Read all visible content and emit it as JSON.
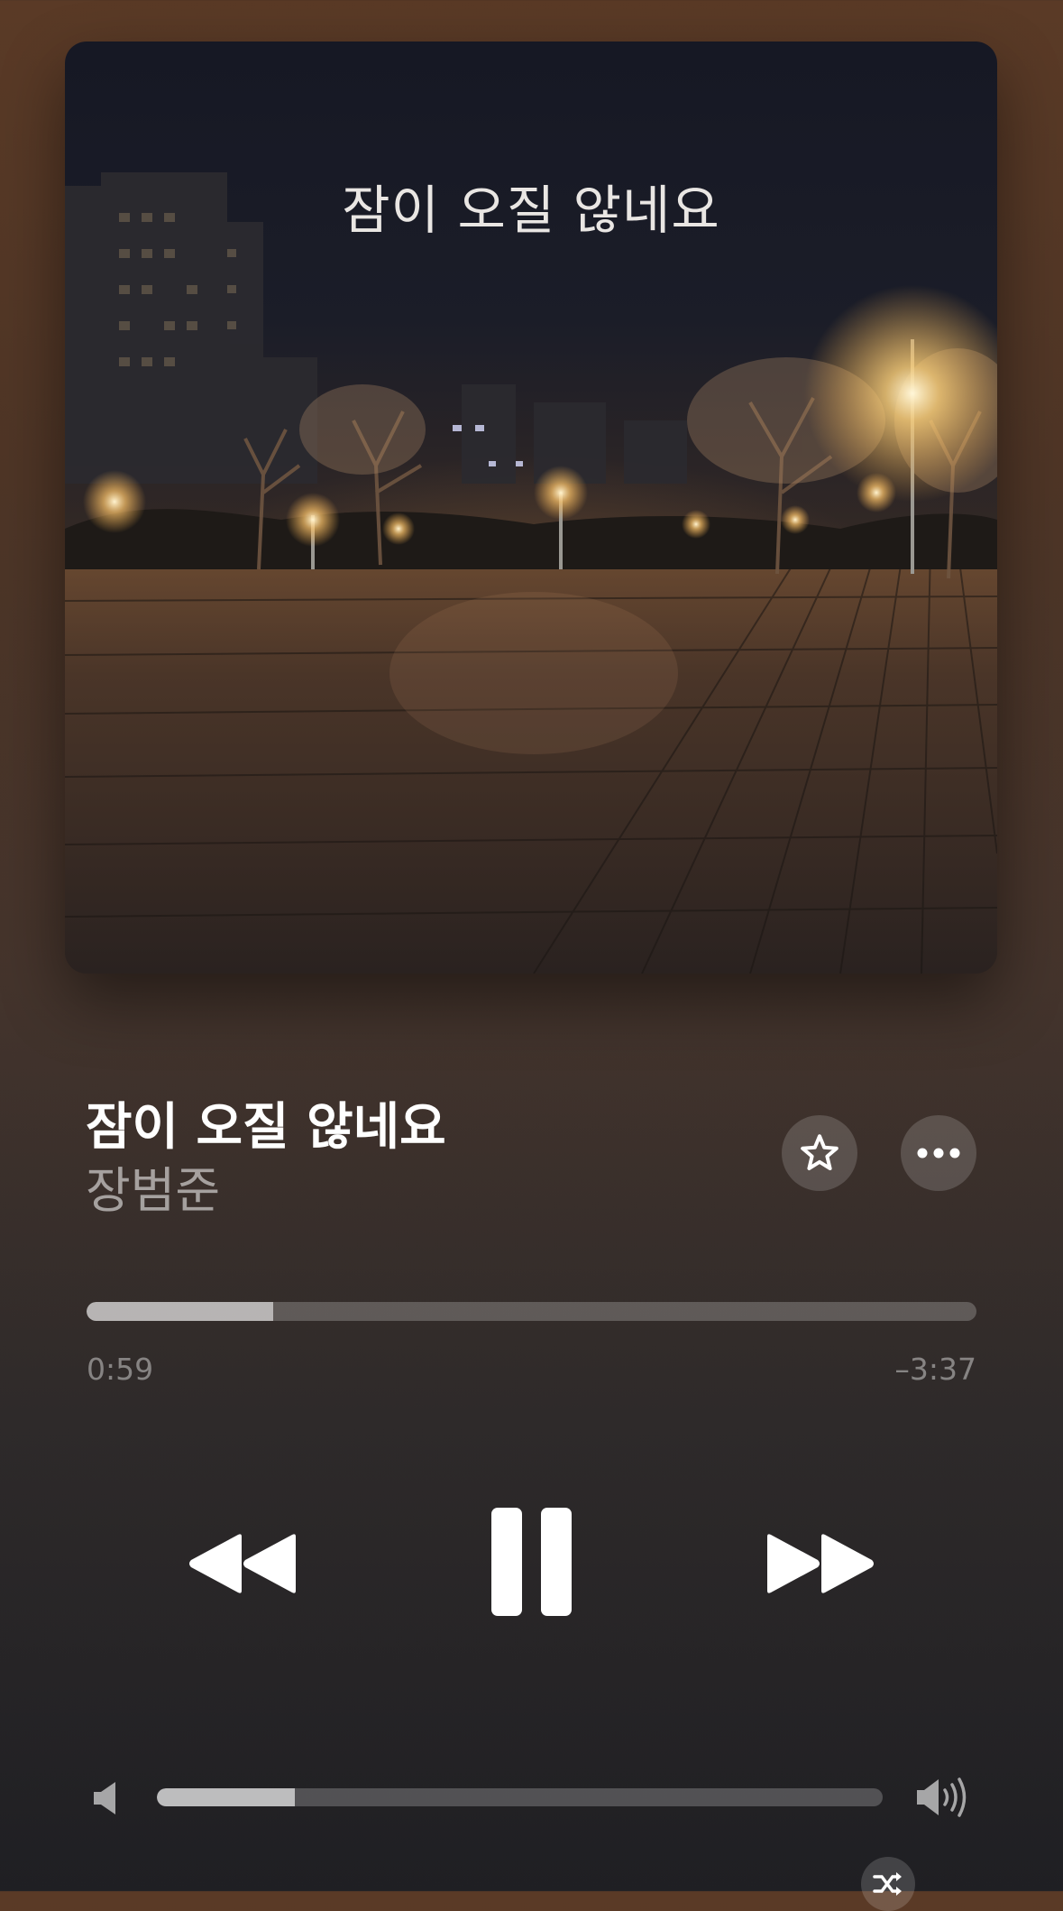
{
  "artwork": {
    "cover_text": "잠이 오질 않네요"
  },
  "track": {
    "title": "잠이 오질 않네요",
    "artist": "장범준"
  },
  "playback": {
    "elapsed": "0:59",
    "remaining": "–3:37",
    "progress_fraction": 0.21
  },
  "volume": {
    "level_fraction": 0.19
  },
  "icons": {
    "favorite": "star-icon",
    "more": "ellipsis-icon",
    "previous": "rewind-icon",
    "play_pause": "pause-icon",
    "next": "fast-forward-icon",
    "volume_low": "speaker-low-icon",
    "volume_high": "speaker-high-icon",
    "shuffle": "shuffle-icon"
  },
  "colors": {
    "background_top": "#5a3a26",
    "background_bottom": "#1f1f23",
    "control_fill": "#ffffff"
  }
}
